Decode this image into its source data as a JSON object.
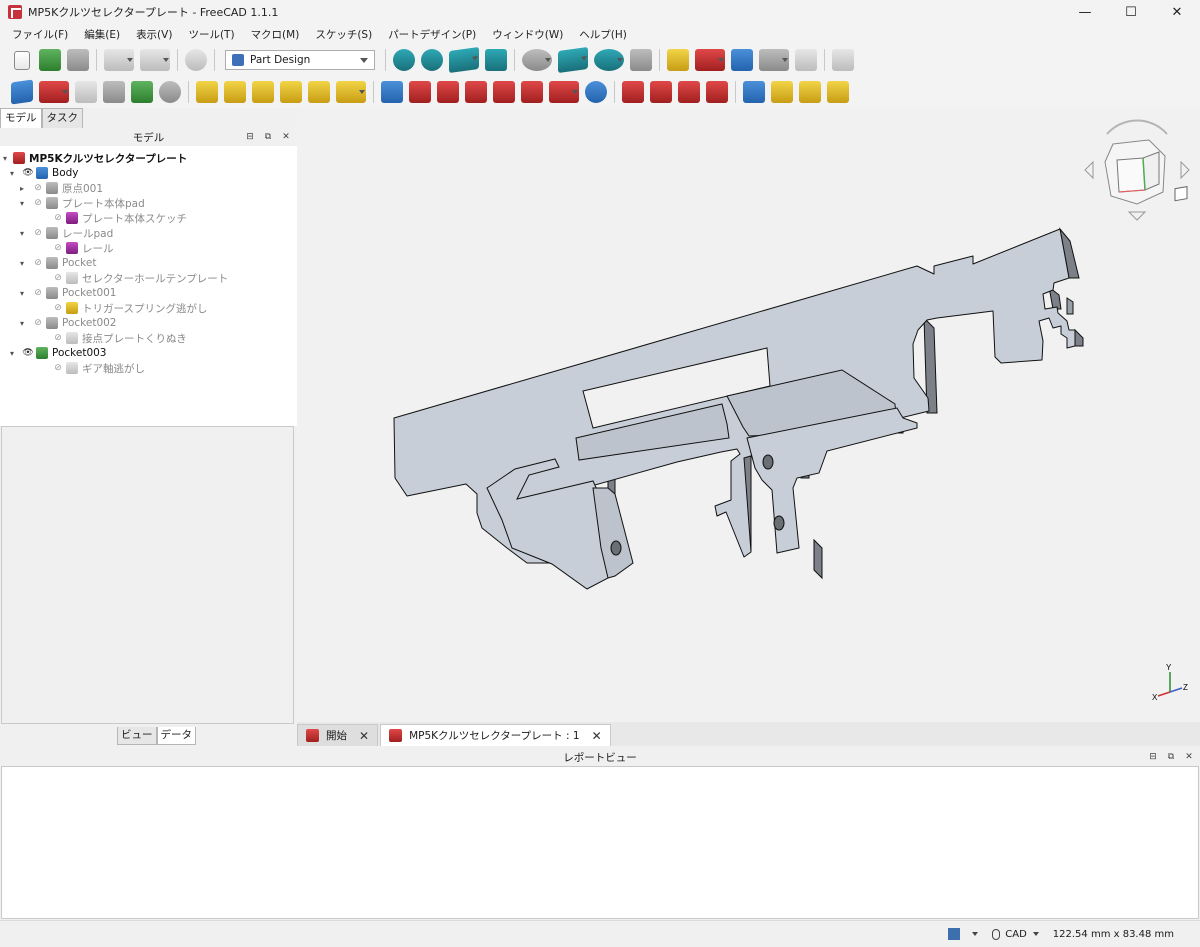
{
  "window": {
    "title": "MP5Kクルツセレクタープレート - FreeCAD 1.1.1"
  },
  "window_controls": {
    "minimize": "—",
    "maximize": "☐",
    "close": "✕"
  },
  "menu": [
    "ファイル(F)",
    "編集(E)",
    "表示(V)",
    "ツール(T)",
    "マクロ(M)",
    "スケッチ(S)",
    "パートデザイン(P)",
    "ウィンドウ(W)",
    "ヘルプ(H)"
  ],
  "workbench": {
    "selected": "Part Design"
  },
  "left_tabs": {
    "model": "モデル",
    "task": "タスク"
  },
  "model_panel": {
    "title": "モデル",
    "btn_float": "⊟",
    "btn_restore": "⧉",
    "btn_close": "✕"
  },
  "tree": [
    {
      "label": "MP5Kクルツセレクタープレート",
      "arrow": "▾",
      "eye": "",
      "style": "bold"
    },
    {
      "label": "Body",
      "arrow": "▾",
      "eye": "👁",
      "style": "dark"
    },
    {
      "label": "原点001",
      "arrow": "▸",
      "eye": "⊘",
      "style": ""
    },
    {
      "label": "プレート本体pad",
      "arrow": "▾",
      "eye": "⊘",
      "style": ""
    },
    {
      "label": "プレート本体スケッチ",
      "arrow": "",
      "eye": "⊘",
      "style": ""
    },
    {
      "label": "レールpad",
      "arrow": "▾",
      "eye": "⊘",
      "style": ""
    },
    {
      "label": "レール",
      "arrow": "",
      "eye": "⊘",
      "style": ""
    },
    {
      "label": "Pocket",
      "arrow": "▾",
      "eye": "⊘",
      "style": ""
    },
    {
      "label": "セレクターホールテンプレート",
      "arrow": "",
      "eye": "⊘",
      "style": ""
    },
    {
      "label": "Pocket001",
      "arrow": "▾",
      "eye": "⊘",
      "style": ""
    },
    {
      "label": "トリガースプリング逃がし",
      "arrow": "",
      "eye": "⊘",
      "style": ""
    },
    {
      "label": "Pocket002",
      "arrow": "▾",
      "eye": "⊘",
      "style": ""
    },
    {
      "label": "接点プレートくりぬき",
      "arrow": "",
      "eye": "⊘",
      "style": ""
    },
    {
      "label": "Pocket003",
      "arrow": "▾",
      "eye": "👁",
      "style": "dark"
    },
    {
      "label": "ギア軸逃がし",
      "arrow": "",
      "eye": "⊘",
      "style": ""
    }
  ],
  "bottom_tabs": {
    "view": "ビュー",
    "data": "データ"
  },
  "doc_tabs": [
    {
      "label": "開始",
      "close": "✕"
    },
    {
      "label": "MP5Kクルツセレクタープレート : 1",
      "close": "✕"
    }
  ],
  "report": {
    "title": "レポートビュー",
    "btn_float": "⊟",
    "btn_restore": "⧉",
    "btn_close": "✕"
  },
  "axis": {
    "x": "X",
    "y": "Y",
    "z": "Z"
  },
  "status": {
    "nav_style": "CAD",
    "dimensions": "122.54 mm x 83.48 mm"
  },
  "colors": {
    "part_face": "#c7ced7",
    "part_side": "#7c8088",
    "part_edge": "#111111",
    "accent_red": "#c8323c"
  }
}
